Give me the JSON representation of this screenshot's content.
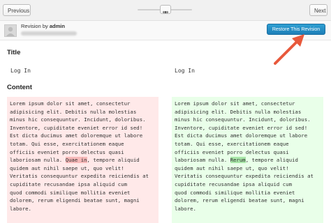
{
  "nav": {
    "previous_label": "Previous",
    "next_label": "Next"
  },
  "revision": {
    "by_prefix": "Revision by ",
    "author": "admin",
    "restore_label": "Restore This Revision"
  },
  "sections": {
    "title_heading": "Title",
    "content_heading": "Content"
  },
  "title": {
    "old": "Log In",
    "new": "Log In"
  },
  "content": {
    "old_lines": [
      "Lorem ipsum dolor sit amet, consectetur",
      "adipisicing elit. Debitis nulla molestias",
      "minus hic consequuntur. Incidunt, doloribus.",
      "Inventore, cupiditate eveniet error id sed!",
      "Est dicta ducimus amet doloremque ut labore",
      "totam. Qui esse, exercitationem eaque",
      "officiis eveniet porro delectus quasi",
      "laboriosam nulla. ",
      "quidem aut nihil saepe ut, quo velit!",
      "Veritatis consequuntur expedita reiciendis at",
      "cupiditate recusandae ipsa aliquid cum",
      "quod commodi similique mollitia eveniet",
      "dolorem, rerum eligendi beatae sunt, magni",
      "labore."
    ],
    "old_changed_word": "Quae in",
    "old_line8_after": ", tempore aliquid",
    "new_lines": [
      "Lorem ipsum dolor sit amet, consectetur",
      "adipisicing elit. Debitis nulla molestias",
      "minus hic consequuntur. Incidunt, doloribus.",
      "Inventore, cupiditate eveniet error id sed!",
      "Est dicta ducimus amet doloremque ut labore",
      "totam. Qui esse, exercitationem eaque",
      "officiis eveniet porro delectus quasi",
      "laboriosam nulla. ",
      "quidem aut nihil saepe ut, quo velit!",
      "Veritatis consequuntur expedita reiciendis at",
      "cupiditate recusandae ipsa aliquid cum",
      "quod commodi similique mollitia eveniet",
      "dolorem, rerum eligendi beatae sunt, magni",
      "labore."
    ],
    "new_changed_word": "Rerum",
    "new_line8_after": ", tempore aliquid"
  },
  "colors": {
    "deleted_bg": "#ffe9e9",
    "added_bg": "#e9ffe9",
    "restore_button": "#2585c3",
    "annotation_arrow": "#e8593c"
  }
}
